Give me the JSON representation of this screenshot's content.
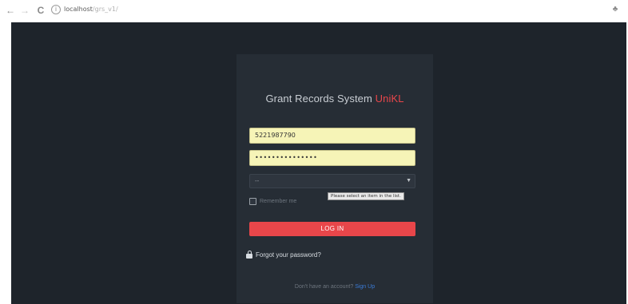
{
  "browser": {
    "back_glyph": "←",
    "forward_glyph": "→",
    "reload_glyph": "C",
    "info_glyph": "i",
    "url_host": "localhost",
    "url_path": "/grs_v1/",
    "ext_glyph": "♣"
  },
  "login": {
    "title": "Grant Records System ",
    "title_brand": "UniKL",
    "user_id_value": "5221987790",
    "password_value": "•••••••••••••••",
    "select_value": "--",
    "select_arrow": "▼",
    "remember_label": "Remember me",
    "tooltip_text": "Please select an item in the list.",
    "login_button": "LOG IN",
    "forgot_label": "Forgot your password?",
    "signup_prompt": "Don't have an account? ",
    "signup_link": "Sign Up"
  },
  "colors": {
    "page_bg": "#1e242b",
    "card_bg": "#262d35",
    "accent": "#e8464a",
    "field_autofill": "#f6f4b7",
    "link": "#3b7bd6"
  }
}
